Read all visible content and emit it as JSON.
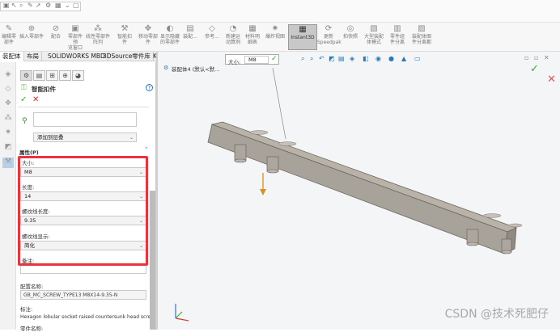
{
  "ribbon": {
    "buttons": [
      {
        "label1": "编辑零",
        "label2": "部件"
      },
      {
        "label1": "插入零部件",
        "label2": ""
      },
      {
        "label1": "配合",
        "label2": ""
      },
      {
        "label1": "零部件预",
        "label2": "览窗口"
      },
      {
        "label1": "线性零部件阵列",
        "label2": ""
      },
      {
        "label1": "智能扣",
        "label2": "件"
      },
      {
        "label1": "移动零部件",
        "label2": ""
      },
      {
        "label1": "显示隐藏",
        "label2": "的零部件"
      },
      {
        "label1": "装配...",
        "label2": ""
      },
      {
        "label1": "参考...",
        "label2": ""
      },
      {
        "label1": "新建运",
        "label2": "动算例"
      },
      {
        "label1": "材料明",
        "label2": "细表"
      },
      {
        "label1": "爆炸视图",
        "label2": ""
      },
      {
        "label1": "Instant3D",
        "label2": ""
      },
      {
        "label1": "更新",
        "label2": "Speedpak"
      },
      {
        "label1": "拍快照",
        "label2": ""
      },
      {
        "label1": "大型装配",
        "label2": "体模式"
      },
      {
        "label1": "零件组",
        "label2": "件分离"
      },
      {
        "label1": "装配体图",
        "label2": "件分离都"
      }
    ]
  },
  "tabs": [
    "装配体",
    "布局",
    "SOLIDWORKS MBD",
    "3DSource零件库",
    "KYTool"
  ],
  "property_manager": {
    "title": "智能扣件",
    "help_icon": "?",
    "add_to_group": "添加到层叠",
    "section_title": "属性(P)",
    "size_label": "大小:",
    "size_value": "M8",
    "length_label": "长度:",
    "length_value": "14",
    "thread_length_label": "螺纹线长度:",
    "thread_length_value": "9.35",
    "thread_display_label": "螺纹线显示:",
    "thread_display_value": "简化",
    "note_label": "备注:",
    "note_value": "",
    "config_label": "配置名称:",
    "config_value": "GB_MC_SCREW_TYPE13 M8X14-9.35-N",
    "title_label": "标注:",
    "title_value": "Hexagon lobular socket raised countersunk head screw",
    "more_label": "零件名称:"
  },
  "viewport": {
    "tree_label": "装配体4 (默认<默...",
    "size_label": "大小:",
    "size_value": "M8"
  },
  "watermark": "CSDN @技术死肥仔",
  "colors": {
    "highlight_box": "#e8343f",
    "confirm": "#2bb12b",
    "cancel": "#d32f2f"
  }
}
